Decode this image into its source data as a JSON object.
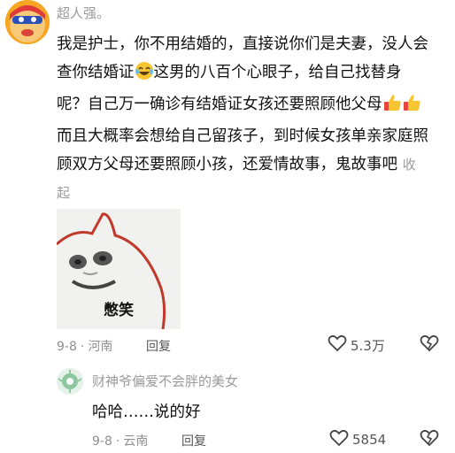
{
  "comment": {
    "username": "超人强。",
    "text": "我是护士，你不用结婚的，直接说你们是夫妻，没人会查你结婚证",
    "text2": "这男的八百个心眼子，给自己找替身呢？自己万一确诊有结婚证女孩还要照顾他父母",
    "text3": "而且大概率会想给自己留孩子，到时候女孩单亲家庭照顾双方父母还要照顾小孩，还爱情故事，鬼故事吧",
    "collapse_label": "收起",
    "meme_caption": "憋笑",
    "date": "9-8",
    "location": "河南",
    "reply_label": "回复",
    "like_count": "5.3万"
  },
  "reply": {
    "username": "财神爷偏爱不会胖的美女",
    "text": "哈哈……说的好",
    "date": "9-8",
    "location": "云南",
    "reply_label": "回复",
    "like_count": "5854"
  },
  "icons": {
    "laugh_emoji": "laughing-crying-emoji",
    "thumbs_up": "thumbs-up-emoji",
    "like": "heart-outline-icon",
    "dislike": "broken-heart-icon"
  },
  "colors": {
    "meta_gray": "#8f8f8f",
    "emoji_yellow": "#f7c531",
    "thumb_red": "#e8453c"
  }
}
